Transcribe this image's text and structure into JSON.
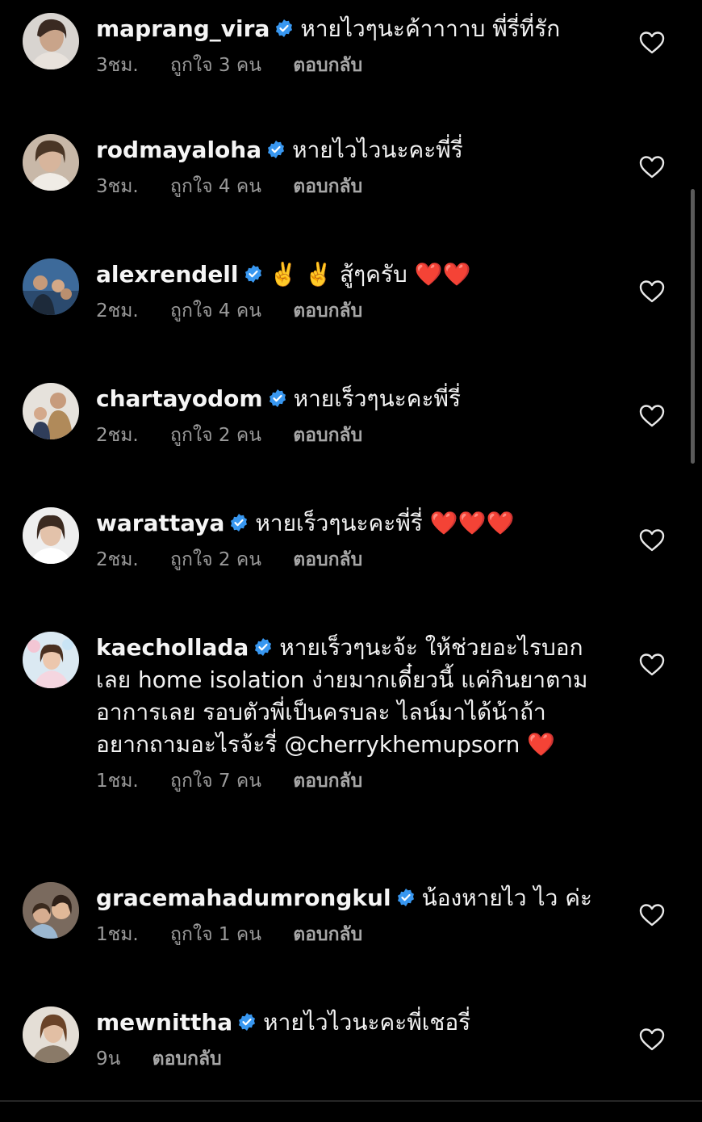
{
  "comments": [
    {
      "username": "maprang_vira",
      "text": "หายไวๆนะค้าาาาบ พี่รี่ที่รัก",
      "time": "3ชม.",
      "likes": "ถูกใจ 3 คน",
      "reply": "ตอบกลับ",
      "verified": true
    },
    {
      "username": "rodmayaloha",
      "text": "หายไวไวนะคะพี่รี่",
      "time": "3ชม.",
      "likes": "ถูกใจ 4 คน",
      "reply": "ตอบกลับ",
      "verified": true
    },
    {
      "username": "alexrendell",
      "text": "✌️ ✌️ สู้ๆครับ ❤️❤️",
      "time": "2ชม.",
      "likes": "ถูกใจ 4 คน",
      "reply": "ตอบกลับ",
      "verified": true
    },
    {
      "username": "chartayodom",
      "text": "หายเร็วๆนะคะพี่รี่",
      "time": "2ชม.",
      "likes": "ถูกใจ 2 คน",
      "reply": "ตอบกลับ",
      "verified": true
    },
    {
      "username": "warattaya",
      "text": "หายเร็วๆนะคะพี่รี่ ❤️❤️❤️",
      "time": "2ชม.",
      "likes": "ถูกใจ 2 คน",
      "reply": "ตอบกลับ",
      "verified": true
    },
    {
      "username": "kaechollada",
      "text": "หายเร็วๆนะจ้ะ ให้ช่วยอะไรบอกเลย home isolation ง่ายมากเดี๋ยวนี้ แค่กินยาตามอาการเลย รอบตัวพี่เป็นครบละ ไลน์มาได้น้าถ้าอยากถามอะไรจ้ะรี่ @cherrykhemupsorn ❤️",
      "time": "1ชม.",
      "likes": "ถูกใจ 7 คน",
      "reply": "ตอบกลับ",
      "verified": true
    },
    {
      "username": "gracemahadumrongkul",
      "text": "น้องหายไว ไว ค่ะ",
      "time": "1ชม.",
      "likes": "ถูกใจ 1 คน",
      "reply": "ตอบกลับ",
      "verified": true
    },
    {
      "username": "mewnittha",
      "text": "หายไวไวนะคะพี่เชอรี่",
      "time": "9น",
      "likes": "",
      "reply": "ตอบกลับ",
      "verified": true
    }
  ],
  "icons": {
    "verified": "verified-badge-icon",
    "like": "heart-outline-icon"
  },
  "colors": {
    "background": "#000000",
    "text": "#f2f2f2",
    "meta": "#9a9a9a",
    "verified": "#3897f0",
    "heart": "#ff1f2f"
  }
}
